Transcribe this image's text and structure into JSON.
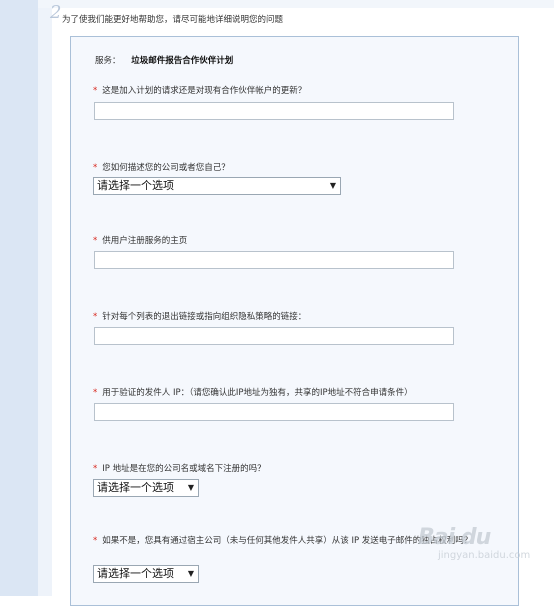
{
  "step": {
    "number": "2",
    "heading": "为了使我们能更好地帮助您，请尽可能地详细说明您的问题"
  },
  "service": {
    "label": "服务：",
    "value": "垃圾邮件报告合作伙伴计划"
  },
  "questions": [
    {
      "label": "这是加入计划的请求还是对现有合作伙伴帐户的更新？",
      "required": "*",
      "input_value": ""
    },
    {
      "label": "您如何描述您的公司或者您自己？",
      "required": "*",
      "select_value": "请选择一个选项"
    },
    {
      "label": "供用户注册服务的主页",
      "required": "*",
      "input_value": ""
    },
    {
      "label": "针对每个列表的退出链接或指向组织隐私策略的链接：",
      "required": "*",
      "input_value": ""
    },
    {
      "label": "用于验证的发件人 IP：（请您确认此IP地址为独有，共享的IP地址不符合申请条件）",
      "required": "*",
      "input_value": ""
    },
    {
      "label": "IP 地址是在您的公司名或域名下注册的吗？",
      "required": "*",
      "select_value": "请选择一个选项"
    },
    {
      "label": "如果不是，您具有通过宿主公司（未与任何其他发件人共享）从该 IP 发送电子邮件的独占权利吗？",
      "required": "*",
      "select_value": "请选择一个选项"
    }
  ],
  "watermark": {
    "logo": "Bai du",
    "sub": "jingyan.baidu.com"
  }
}
